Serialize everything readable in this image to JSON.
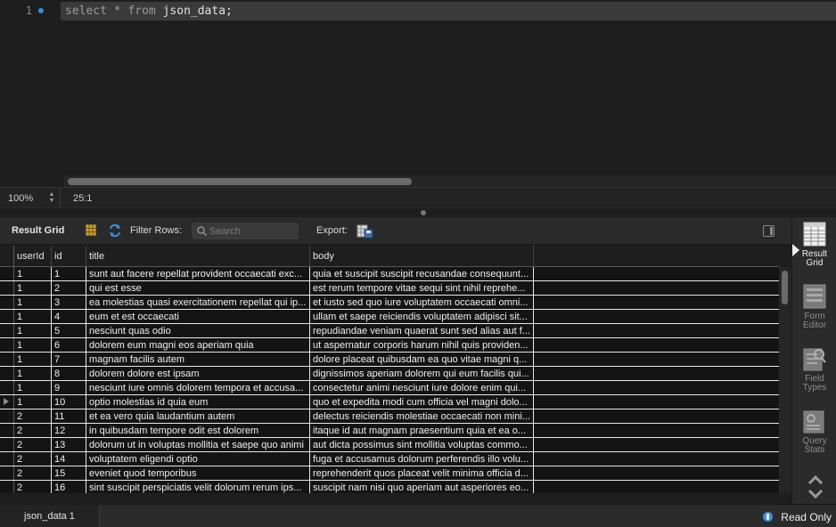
{
  "editor": {
    "line_number": "1",
    "code_keyword_select": "select",
    "code_star": "*",
    "code_keyword_from": "from",
    "code_table": "json_data;"
  },
  "editor_status": {
    "zoom": "100%",
    "cursor_position": "25:1"
  },
  "result_toolbar": {
    "title": "Result Grid",
    "filter_label": "Filter Rows:",
    "search_placeholder": "Search",
    "search_value": "",
    "export_label": "Export:"
  },
  "grid": {
    "columns": [
      "userId",
      "id",
      "title",
      "body"
    ],
    "current_row_index": 9,
    "rows": [
      [
        "1",
        "1",
        "sunt aut facere repellat provident occaecati exc...",
        "quia et suscipit suscipit recusandae consequunt..."
      ],
      [
        "1",
        "2",
        "qui est esse",
        "est rerum tempore vitae sequi sint nihil reprehe..."
      ],
      [
        "1",
        "3",
        "ea molestias quasi exercitationem repellat qui ip...",
        "et iusto sed quo iure voluptatem occaecati omni..."
      ],
      [
        "1",
        "4",
        "eum et est occaecati",
        "ullam et saepe reiciendis voluptatem adipisci sit..."
      ],
      [
        "1",
        "5",
        "nesciunt quas odio",
        "repudiandae veniam quaerat sunt sed alias aut f..."
      ],
      [
        "1",
        "6",
        "dolorem eum magni eos aperiam quia",
        "ut aspernatur corporis harum nihil quis providen..."
      ],
      [
        "1",
        "7",
        "magnam facilis autem",
        "dolore placeat quibusdam ea quo vitae magni q..."
      ],
      [
        "1",
        "8",
        "dolorem dolore est ipsam",
        "dignissimos aperiam dolorem qui eum facilis qui..."
      ],
      [
        "1",
        "9",
        "nesciunt iure omnis dolorem tempora et accusa...",
        "consectetur animi nesciunt iure dolore enim qui..."
      ],
      [
        "1",
        "10",
        "optio molestias id quia eum",
        "quo et expedita modi cum officia vel magni dolo..."
      ],
      [
        "2",
        "11",
        "et ea vero quia laudantium autem",
        "delectus reiciendis molestiae occaecati non mini..."
      ],
      [
        "2",
        "12",
        "in quibusdam tempore odit est dolorem",
        "itaque id aut magnam praesentium quia et ea o..."
      ],
      [
        "2",
        "13",
        "dolorum ut in voluptas mollitia et saepe quo animi",
        "aut dicta possimus sint mollitia voluptas commo..."
      ],
      [
        "2",
        "14",
        "voluptatem eligendi optio",
        "fuga et accusamus dolorum perferendis illo volu..."
      ],
      [
        "2",
        "15",
        "eveniet quod temporibus",
        "reprehenderit quos placeat velit minima officia d..."
      ],
      [
        "2",
        "16",
        "sint suscipit perspiciatis velit dolorum rerum ips...",
        "suscipit nam nisi quo aperiam aut asperiores eo..."
      ]
    ]
  },
  "side_panel": {
    "result_grid_line1": "Result",
    "result_grid_line2": "Grid",
    "form_editor_line1": "Form",
    "form_editor_line2": "Editor",
    "field_types_line1": "Field",
    "field_types_line2": "Types",
    "query_stats_line1": "Query",
    "query_stats_line2": "Stats"
  },
  "tab_bar": {
    "tab_label": "json_data 1",
    "status": "Read Only"
  },
  "colors": {
    "accent": "#3d8ee0",
    "background": "#1e1e1e",
    "grid_line": "#e8e8e8"
  }
}
